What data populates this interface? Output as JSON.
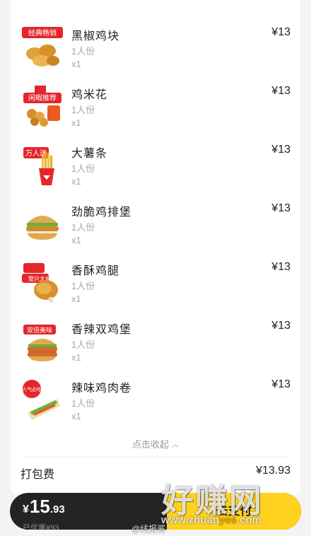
{
  "items": [
    {
      "name": "黑椒鸡块",
      "spec": "1人份",
      "qty": "x1",
      "price": "¥13",
      "badge": "经典畅销",
      "icon": "nuggets-icon"
    },
    {
      "name": "鸡米花",
      "spec": "1人份",
      "qty": "x1",
      "price": "¥13",
      "badge": "闲暇推荐",
      "icon": "popcorn-chicken-icon"
    },
    {
      "name": "大薯条",
      "spec": "1人份",
      "qty": "x1",
      "price": "¥13",
      "badge": "万人迷",
      "icon": "fries-icon"
    },
    {
      "name": "劲脆鸡排堡",
      "spec": "1人份",
      "qty": "x1",
      "price": "¥13",
      "badge": "",
      "icon": "burger-icon"
    },
    {
      "name": "香酥鸡腿",
      "spec": "1人份",
      "qty": "x1",
      "price": "¥13",
      "badge": "整只大鸡腿",
      "icon": "drumstick-icon"
    },
    {
      "name": "香辣双鸡堡",
      "spec": "1人份",
      "qty": "x1",
      "price": "¥13",
      "badge": "双倍美味",
      "icon": "double-burger-icon"
    },
    {
      "name": "辣味鸡肉卷",
      "spec": "1人份",
      "qty": "x1",
      "price": "¥13",
      "badge": "人气必吃",
      "icon": "wrap-icon"
    }
  ],
  "collapse": {
    "label": "点击收起",
    "icon": "chevron-up-icon"
  },
  "packaging": {
    "label": "打包费",
    "price": "¥13.93"
  },
  "footer": {
    "currency": "¥",
    "total_int": "15",
    "total_dec": ".93",
    "discount": "已优惠¥93",
    "pay_label": "去支付"
  },
  "watermark": {
    "main": "好赚网",
    "url_a": "www.zhuan",
    "url_b": "yes",
    "url_c": ".com",
    "weibo": "@线报酱"
  },
  "colors": {
    "accent": "#ffd21f",
    "bar": "#242424",
    "badge_red": "#e4262b"
  }
}
